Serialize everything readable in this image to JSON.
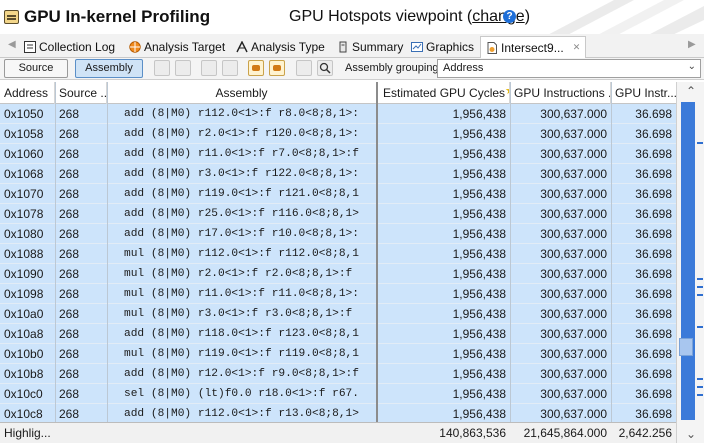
{
  "header": {
    "title": "GPU In-kernel Profiling",
    "viewpoint_label": "GPU Hotspots viewpoint (",
    "change_link": "change",
    "viewpoint_close": ")",
    "help_glyph": "?"
  },
  "tabs": [
    {
      "label": "Collection Log",
      "icon": "collection-log-icon"
    },
    {
      "label": "Analysis Target",
      "icon": "analysis-target-icon"
    },
    {
      "label": "Analysis Type",
      "icon": "analysis-type-icon"
    },
    {
      "label": "Summary",
      "icon": "summary-icon"
    },
    {
      "label": "Graphics",
      "icon": "graphics-icon"
    },
    {
      "label": "Intersect9...",
      "icon": "source-file-icon",
      "active": true
    }
  ],
  "tab_close_glyph": "✕",
  "toolbar": {
    "source_label": "Source",
    "assembly_label": "Assembly",
    "grouping_label": "Assembly grouping:",
    "grouping_value": "Address"
  },
  "columns": {
    "address": "Address",
    "source": "Source ...",
    "assembly": "Assembly",
    "cycles": "Estimated GPU Cycles",
    "instructions": "GPU Instructions ...",
    "instr2": "GPU Instr..."
  },
  "rows": [
    {
      "address": "0x1050",
      "source": "268",
      "assembly": "add (8|M0) r112.0<1>:f r8.0<8;8,1>:",
      "cycles": "1,956,438",
      "instructions": "300,637.000",
      "instr2": "36.698"
    },
    {
      "address": "0x1058",
      "source": "268",
      "assembly": "add (8|M0) r2.0<1>:f r120.0<8;8,1>:",
      "cycles": "1,956,438",
      "instructions": "300,637.000",
      "instr2": "36.698"
    },
    {
      "address": "0x1060",
      "source": "268",
      "assembly": "add (8|M0) r11.0<1>:f r7.0<8;8,1>:f",
      "cycles": "1,956,438",
      "instructions": "300,637.000",
      "instr2": "36.698"
    },
    {
      "address": "0x1068",
      "source": "268",
      "assembly": "add (8|M0) r3.0<1>:f r122.0<8;8,1>:",
      "cycles": "1,956,438",
      "instructions": "300,637.000",
      "instr2": "36.698"
    },
    {
      "address": "0x1070",
      "source": "268",
      "assembly": "add (8|M0) r119.0<1>:f r121.0<8;8,1",
      "cycles": "1,956,438",
      "instructions": "300,637.000",
      "instr2": "36.698"
    },
    {
      "address": "0x1078",
      "source": "268",
      "assembly": "add (8|M0) r25.0<1>:f r116.0<8;8,1>",
      "cycles": "1,956,438",
      "instructions": "300,637.000",
      "instr2": "36.698"
    },
    {
      "address": "0x1080",
      "source": "268",
      "assembly": "add (8|M0) r17.0<1>:f r10.0<8;8,1>:",
      "cycles": "1,956,438",
      "instructions": "300,637.000",
      "instr2": "36.698"
    },
    {
      "address": "0x1088",
      "source": "268",
      "assembly": "mul (8|M0) r112.0<1>:f r112.0<8;8,1",
      "cycles": "1,956,438",
      "instructions": "300,637.000",
      "instr2": "36.698"
    },
    {
      "address": "0x1090",
      "source": "268",
      "assembly": "mul (8|M0) r2.0<1>:f r2.0<8;8,1>:f",
      "cycles": "1,956,438",
      "instructions": "300,637.000",
      "instr2": "36.698"
    },
    {
      "address": "0x1098",
      "source": "268",
      "assembly": "mul (8|M0) r11.0<1>:f r11.0<8;8,1>:",
      "cycles": "1,956,438",
      "instructions": "300,637.000",
      "instr2": "36.698"
    },
    {
      "address": "0x10a0",
      "source": "268",
      "assembly": "mul (8|M0) r3.0<1>:f r3.0<8;8,1>:f",
      "cycles": "1,956,438",
      "instructions": "300,637.000",
      "instr2": "36.698"
    },
    {
      "address": "0x10a8",
      "source": "268",
      "assembly": "add (8|M0) r118.0<1>:f r123.0<8;8,1",
      "cycles": "1,956,438",
      "instructions": "300,637.000",
      "instr2": "36.698"
    },
    {
      "address": "0x10b0",
      "source": "268",
      "assembly": "mul (8|M0) r119.0<1>:f r119.0<8;8,1",
      "cycles": "1,956,438",
      "instructions": "300,637.000",
      "instr2": "36.698"
    },
    {
      "address": "0x10b8",
      "source": "268",
      "assembly": "add (8|M0) r12.0<1>:f r9.0<8;8,1>:f",
      "cycles": "1,956,438",
      "instructions": "300,637.000",
      "instr2": "36.698"
    },
    {
      "address": "0x10c0",
      "source": "268",
      "assembly": "sel (8|M0) (lt)f0.0 r18.0<1>:f r67.",
      "cycles": "1,956,438",
      "instructions": "300,637.000",
      "instr2": "36.698"
    },
    {
      "address": "0x10c8",
      "source": "268",
      "assembly": "add (8|M0) r112.0<1>:f r13.0<8;8,1>",
      "cycles": "1,956,438",
      "instructions": "300,637.000",
      "instr2": "36.698"
    }
  ],
  "footer": {
    "label": "Highlig...",
    "cycles": "140,863,536",
    "instructions": "21,645,864.000",
    "instr2": "2,642.256"
  },
  "colors": {
    "row_selected": "#cde4fb",
    "scroll_track": "#3b7ad9"
  }
}
